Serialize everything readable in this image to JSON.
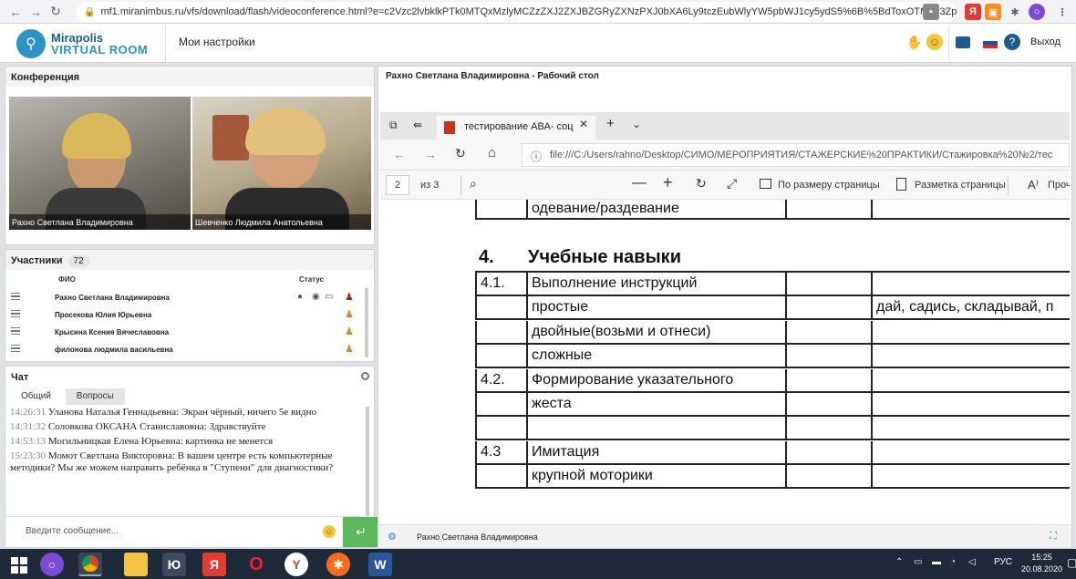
{
  "browser": {
    "url": "mf1.miranimbus.ru/vfs/download/flash/videoconference.html?e=c2Vzc2lvbklkPTk0MTQxMzlyMCZzZXJ2ZXJBZGRyZXNzPXJ0bXA6Ly9tczEubWlyYW5pbWJ1cy5ydS5%6B%5BdToxOTM1L3Zpc..."
  },
  "header": {
    "logo_line1": "Mirapolis",
    "logo_line2": "VIRTUAL ROOM",
    "settings_label": "Мои настройки",
    "exit_label": "Выход"
  },
  "conference": {
    "title": "Конференция",
    "videos": [
      {
        "name": "Рахно Светлана Владимировна"
      },
      {
        "name": "Шевченко  Людмила  Анатольевна"
      }
    ]
  },
  "participants": {
    "title": "Участники",
    "count": "72",
    "col_name": "ФИО",
    "col_status": "Статус",
    "rows": [
      {
        "name": "Рахно Светлана Владимировна"
      },
      {
        "name": "Просекова  Юлия  Юрьевна"
      },
      {
        "name": "Крысина Ксения  Вячеславовна"
      },
      {
        "name": "филонова людмила  васильевна"
      }
    ]
  },
  "chat": {
    "title": "Чат",
    "tabs": [
      "Общий",
      "Вопросы"
    ],
    "messages": [
      {
        "time": "14:26:31",
        "text": "Уланова  Наталья Геннадьевна: Экран чёрный, ничего 5е видно"
      },
      {
        "time": "14:31:32",
        "text": "Соловкова  ОКСАНА Станиславовна: Здравствуйте"
      },
      {
        "time": "14:53:13",
        "text": "Могильницкая  Елена Юрьевна: картинка не менется"
      },
      {
        "time": "15:23:30",
        "text": "Момот Светлана   Викторовна:  В вашем центре есть компьютерные методики? Мы же можем направить ребёнка в \"Ступени\" для диагностики?"
      }
    ],
    "input_placeholder": "Введите сообщение...",
    "send_icon": "↵"
  },
  "desktop": {
    "title": "Рахно Светлана Владимировна - Рабочий стол",
    "footer_name": "Рахно Светлана Владимировна",
    "edge": {
      "tab_title": "тестирование АВА- соц",
      "address": "file:///C:/Users/rahno/Desktop/СИМО/МЕРОПРИЯТИЯ/СТАЖЕРСКИЕ%20ПРАКТИКИ/Стажировка%20№2/тес",
      "page": "2",
      "of_pages": "из 3",
      "fit_label": "По размеру страницы",
      "layout_label": "Разметка страницы",
      "read_label": "Прочи"
    },
    "doc": {
      "top_row": "одевание/раздевание",
      "section_num": "4.",
      "section_title": "Учебные навыки",
      "rows": [
        {
          "num": "4.1.",
          "text": "Выполнение инструкций",
          "note": ""
        },
        {
          "num": "",
          "text": "простые",
          "note": "дай, садись, складывай, п"
        },
        {
          "num": "",
          "text": "двойные(возьми и отнеси)",
          "note": ""
        },
        {
          "num": "",
          "text": "сложные",
          "note": ""
        },
        {
          "num": "4.2.",
          "text": "Формирование указательного",
          "note": ""
        },
        {
          "num": "",
          "text": "жеста",
          "note": ""
        },
        {
          "num": "",
          "text": "",
          "note": ""
        },
        {
          "num": "4.3",
          "text": "Имитация",
          "note": ""
        },
        {
          "num": "",
          "text": "крупной моторики",
          "note": ""
        }
      ]
    }
  },
  "taskbar": {
    "lang": "РУС",
    "time": "15:25",
    "date": "20.08.2020"
  }
}
